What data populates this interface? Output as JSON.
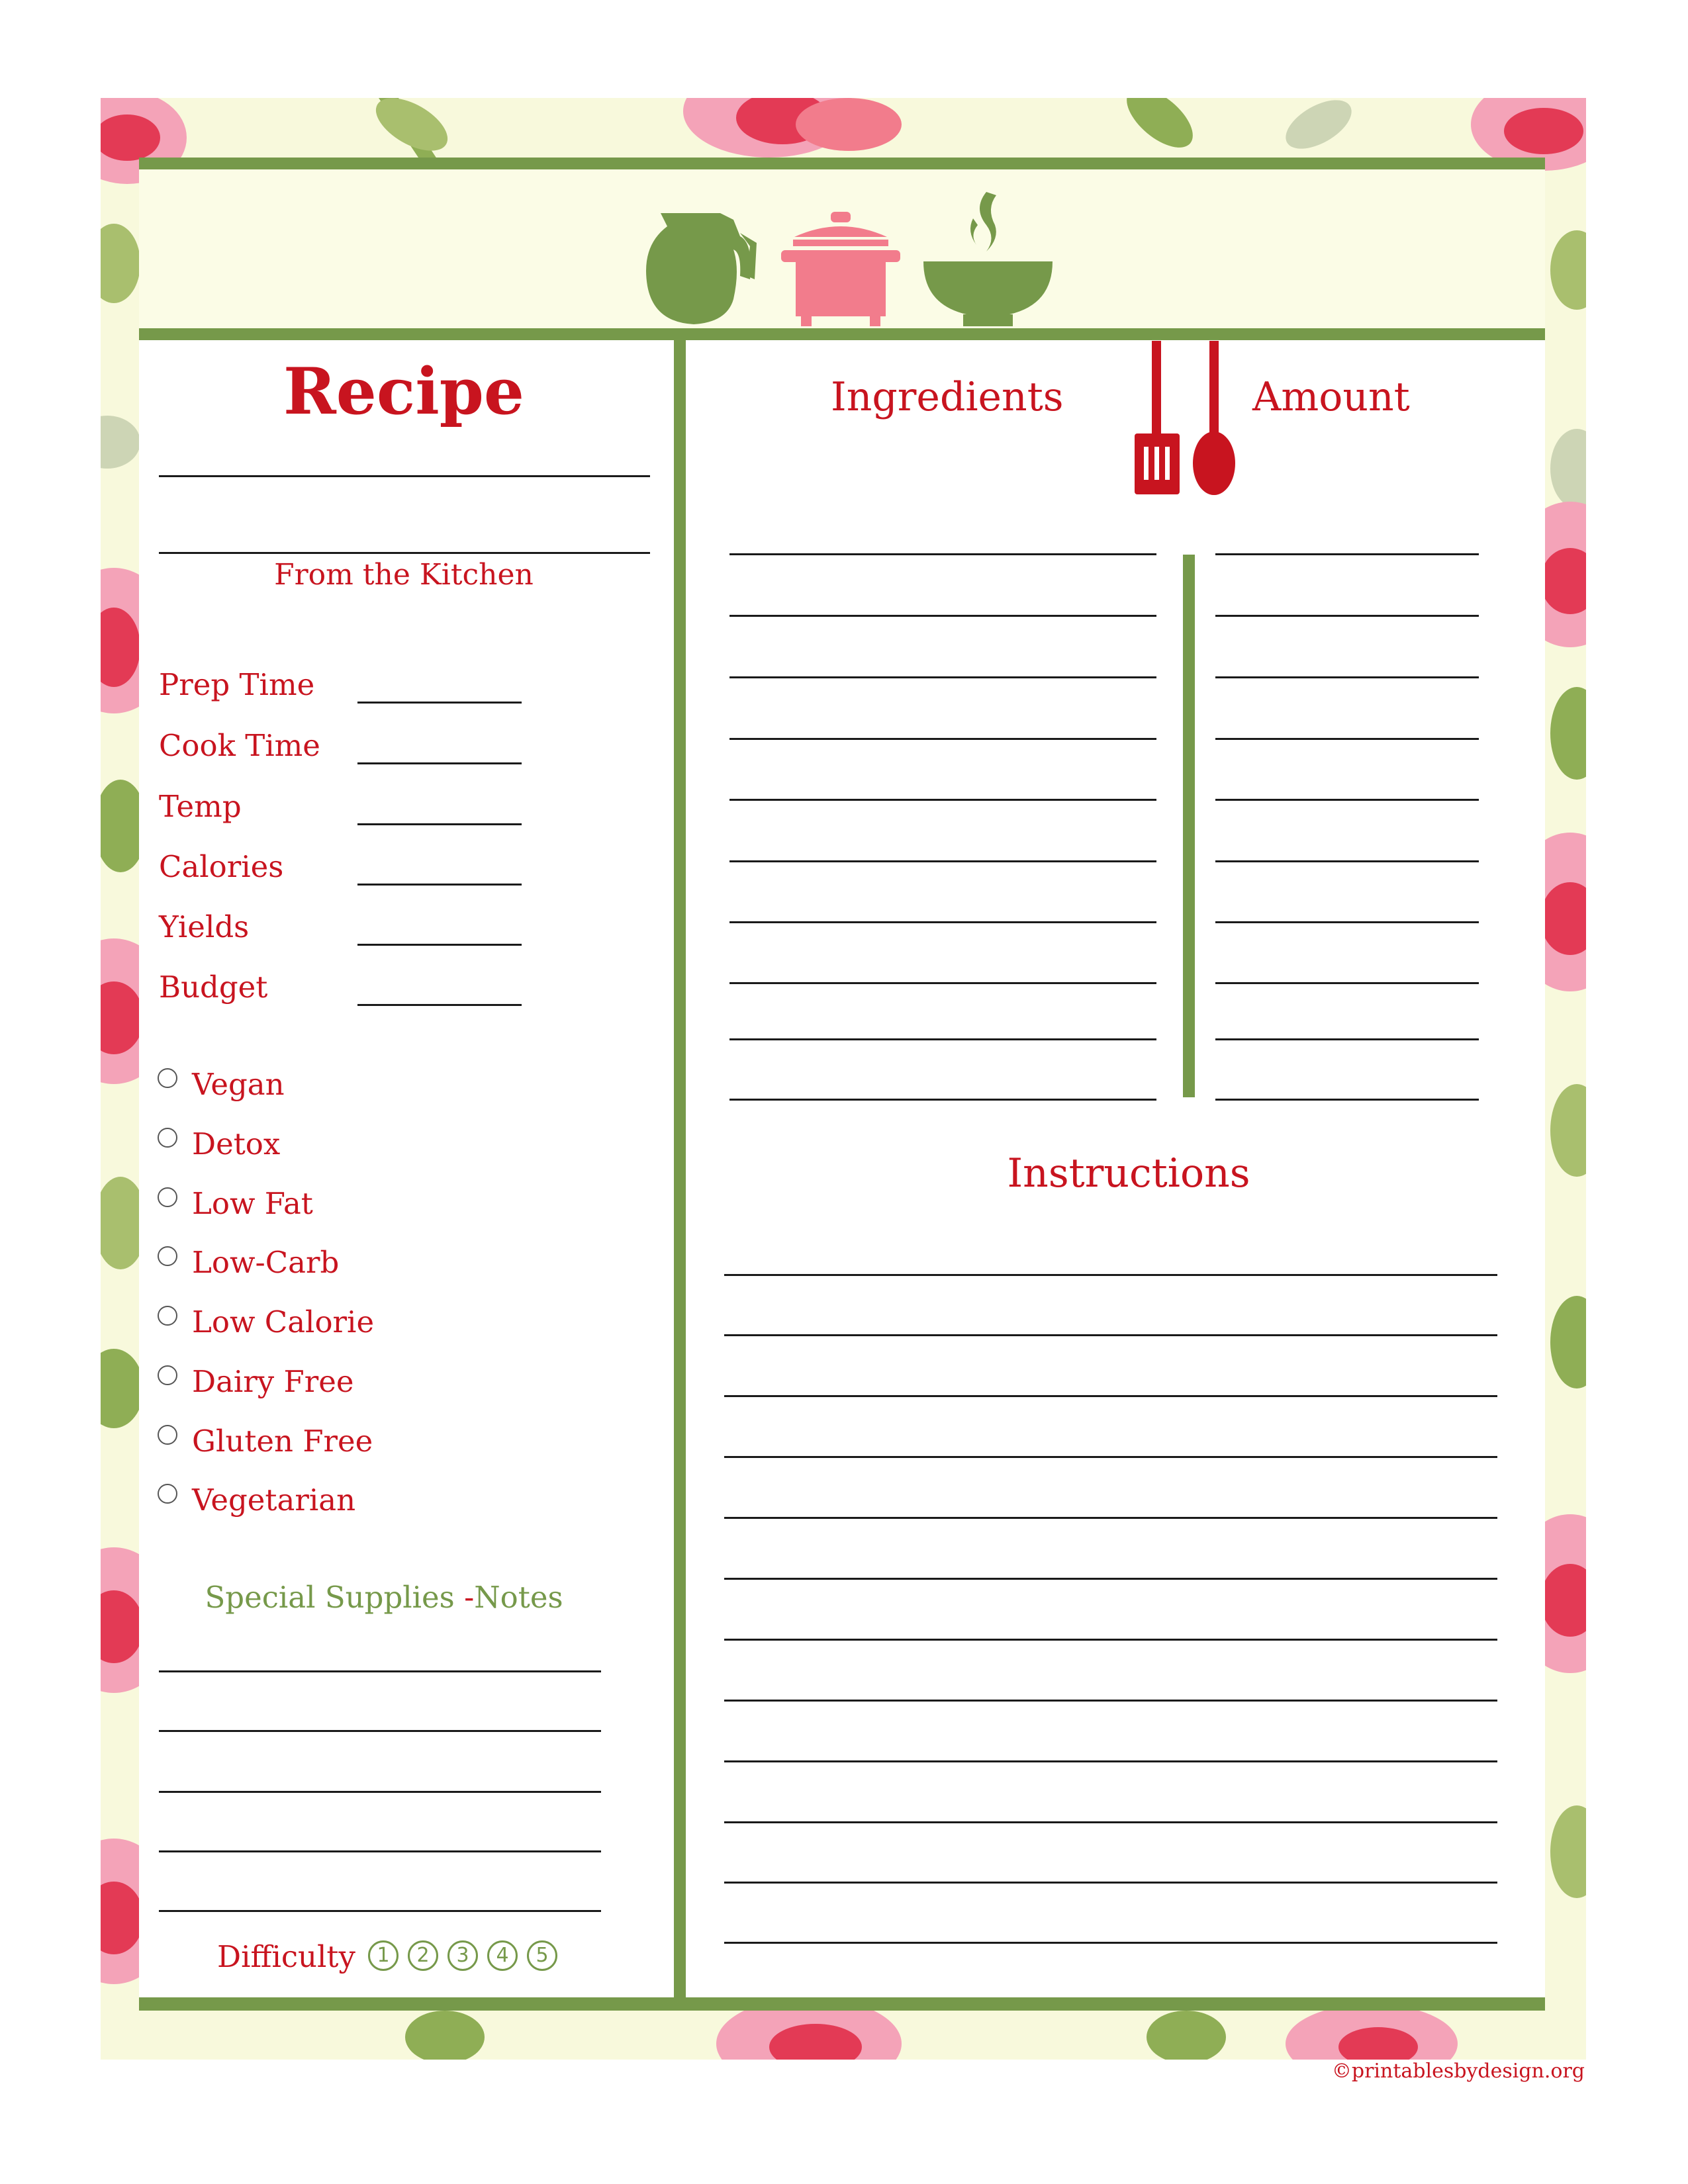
{
  "title": "Recipe",
  "subtitle": "From the Kitchen",
  "fields": [
    {
      "label": "Prep Time"
    },
    {
      "label": "Cook Time"
    },
    {
      "label": "Temp"
    },
    {
      "label": "Calories"
    },
    {
      "label": "Yields"
    },
    {
      "label": "Budget"
    }
  ],
  "diet_options": [
    "Vegan",
    "Detox",
    "Low Fat",
    "Low-Carb",
    "Low Calorie",
    "Dairy Free",
    "Gluten Free",
    "Vegetarian"
  ],
  "notes": {
    "part1": "Special Supplies ",
    "dash": "-",
    "part2": "Notes"
  },
  "difficulty": {
    "label": "Difficulty",
    "levels": [
      "1",
      "2",
      "3",
      "4",
      "5"
    ]
  },
  "ingredients_heading": "Ingredients",
  "amount_heading": "Amount",
  "instructions_heading": "Instructions",
  "copyright": "©printablesbydesign.org",
  "icons": [
    "pitcher-icon",
    "pot-icon",
    "bowl-icon",
    "spatula-icon",
    "spoon-icon"
  ],
  "colors": {
    "green": "#76994a",
    "red": "#c8141f",
    "pink": "#f27c8c",
    "cream": "#f8f9dc"
  }
}
